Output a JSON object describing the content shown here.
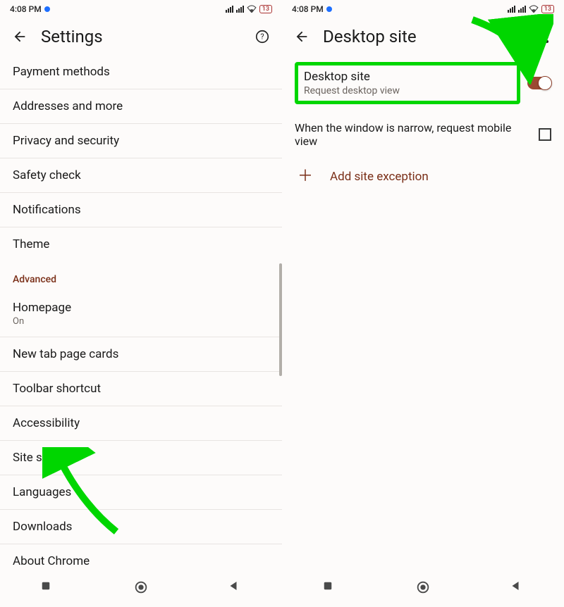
{
  "status": {
    "time": "4:08 PM",
    "battery": "13"
  },
  "left": {
    "title": "Settings",
    "items": [
      "Payment methods",
      "Addresses and more",
      "Privacy and security",
      "Safety check",
      "Notifications",
      "Theme"
    ],
    "advanced_label": "Advanced",
    "homepage": {
      "title": "Homepage",
      "sub": "On"
    },
    "items2": [
      "New tab page cards",
      "Toolbar shortcut",
      "Accessibility",
      "Site settings",
      "Languages",
      "Downloads",
      "About Chrome"
    ]
  },
  "right": {
    "title": "Desktop site",
    "desktop_site": {
      "title": "Desktop site",
      "sub": "Request desktop view"
    },
    "narrow_text": "When the window is narrow, request mobile view",
    "add_exception": "Add site exception"
  }
}
